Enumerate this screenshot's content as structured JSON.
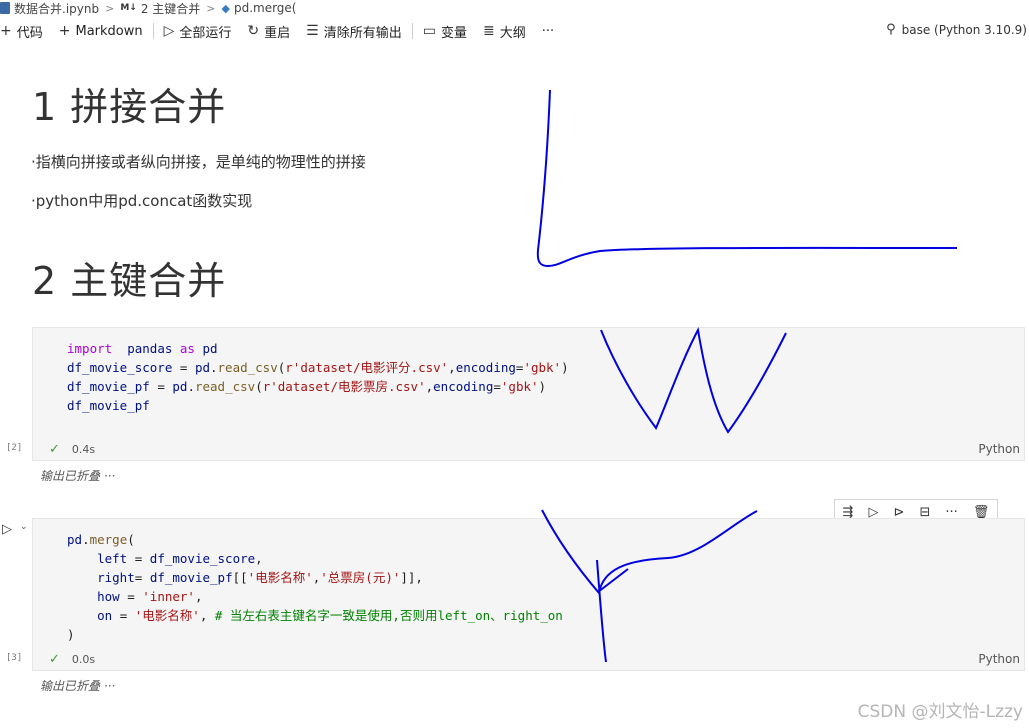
{
  "breadcrumb": {
    "file": "数据合并.ipynb",
    "section": "2 主键合并",
    "cell": "pd.merge(",
    "md_badge": "M↓"
  },
  "toolbar": {
    "code": "代码",
    "markdown": "Markdown",
    "run_all": "全部运行",
    "restart": "重启",
    "clear_outputs": "清除所有输出",
    "variables": "变量",
    "outline": "大纲",
    "more": "···"
  },
  "kernel": "base (Python 3.10.9)",
  "markdown": {
    "heading1": "1 拼接合并",
    "para1": "·指横向拼接或者纵向拼接，是单纯的物理性的拼接",
    "para2": "·python中用pd.concat函数实现",
    "heading2": "2 主键合并"
  },
  "cell1": {
    "exec_count": "[2]",
    "lines": [
      [
        [
          "kw",
          "import"
        ],
        [
          "",
          "  "
        ],
        [
          "var",
          "pandas"
        ],
        [
          "",
          " "
        ],
        [
          "kw",
          "as"
        ],
        [
          "",
          " "
        ],
        [
          "var",
          "pd"
        ]
      ],
      [
        [
          "var",
          "df_movie_score"
        ],
        [
          "",
          " = "
        ],
        [
          "var",
          "pd"
        ],
        [
          "",
          "."
        ],
        [
          "fn",
          "read_csv"
        ],
        [
          "",
          "("
        ],
        [
          "str",
          "r'dataset/电影评分.csv'"
        ],
        [
          "",
          ","
        ],
        [
          "var",
          "encoding"
        ],
        [
          "",
          "="
        ],
        [
          "str",
          "'gbk'"
        ],
        [
          "",
          ")"
        ]
      ],
      [
        [
          "var",
          "df_movie_pf"
        ],
        [
          "",
          " = "
        ],
        [
          "var",
          "pd"
        ],
        [
          "",
          "."
        ],
        [
          "fn",
          "read_csv"
        ],
        [
          "",
          "("
        ],
        [
          "str",
          "r'dataset/电影票房.csv'"
        ],
        [
          "",
          ","
        ],
        [
          "var",
          "encoding"
        ],
        [
          "",
          "="
        ],
        [
          "str",
          "'gbk'"
        ],
        [
          "",
          ")"
        ]
      ],
      [
        [
          "var",
          "df_movie_pf"
        ]
      ]
    ],
    "time": "0.4s",
    "lang": "Python",
    "output_collapsed": "输出已折叠  ···"
  },
  "cell2": {
    "exec_count": "[3]",
    "lines": [
      [
        [
          "var",
          "pd"
        ],
        [
          "",
          "."
        ],
        [
          "fn",
          "merge"
        ],
        [
          "",
          "("
        ]
      ],
      [
        [
          "",
          "    "
        ],
        [
          "var",
          "left"
        ],
        [
          "",
          " = "
        ],
        [
          "var",
          "df_movie_score"
        ],
        [
          "",
          ","
        ]
      ],
      [
        [
          "",
          "    "
        ],
        [
          "var",
          "right"
        ],
        [
          "",
          "= "
        ],
        [
          "var",
          "df_movie_pf"
        ],
        [
          "",
          "[["
        ],
        [
          "str",
          "'电影名称'"
        ],
        [
          "",
          ","
        ],
        [
          "str",
          "'总票房(元)'"
        ],
        [
          "",
          "]],"
        ]
      ],
      [
        [
          "",
          "    "
        ],
        [
          "var",
          "how"
        ],
        [
          "",
          " = "
        ],
        [
          "str",
          "'inner'"
        ],
        [
          "",
          ","
        ]
      ],
      [
        [
          "",
          "    "
        ],
        [
          "var",
          "on"
        ],
        [
          "",
          " = "
        ],
        [
          "str",
          "'电影名称'"
        ],
        [
          "",
          ", "
        ],
        [
          "cm",
          "# 当左右表主键名字一致是使用,否则用left_on、right_on"
        ]
      ],
      [
        [
          "",
          ")"
        ]
      ]
    ],
    "time": "0.0s",
    "lang": "Python",
    "output_collapsed": "输出已折叠  ···"
  },
  "cell_toolbar": [
    "run-by-line-icon",
    "execute-above-icon",
    "execute-below-icon",
    "split-cell-icon",
    "more-icon",
    "delete-icon"
  ],
  "watermark": "CSDN @刘文怡-Lzzy",
  "ink_color": "#0000e0"
}
